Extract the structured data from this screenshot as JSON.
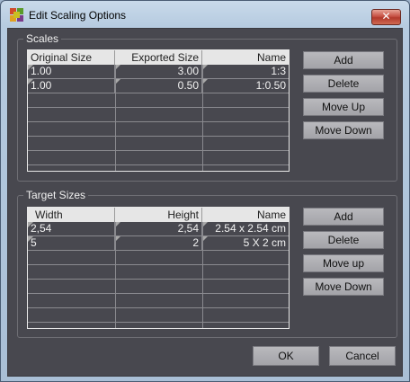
{
  "window": {
    "title": "Edit Scaling Options",
    "close_glyph": "✕"
  },
  "scales": {
    "label": "Scales",
    "columns": [
      "Original Size",
      "Exported Size",
      "Name"
    ],
    "rows": [
      [
        "1.00",
        "3.00",
        "1:3"
      ],
      [
        "1.00",
        "0.50",
        "1:0.50"
      ]
    ],
    "buttons": {
      "add": "Add",
      "delete": "Delete",
      "move_up": "Move Up",
      "move_down": "Move Down"
    }
  },
  "targets": {
    "label": "Target Sizes",
    "columns": [
      "Width",
      "Height",
      "Name"
    ],
    "rows": [
      [
        "2,54",
        "2,54",
        "2.54 x 2.54 cm"
      ],
      [
        "5",
        "2",
        "5 X 2 cm"
      ]
    ],
    "buttons": {
      "add": "Add",
      "delete": "Delete",
      "move_up": "Move up",
      "move_down": "Move Down"
    }
  },
  "footer": {
    "ok": "OK",
    "cancel": "Cancel"
  }
}
